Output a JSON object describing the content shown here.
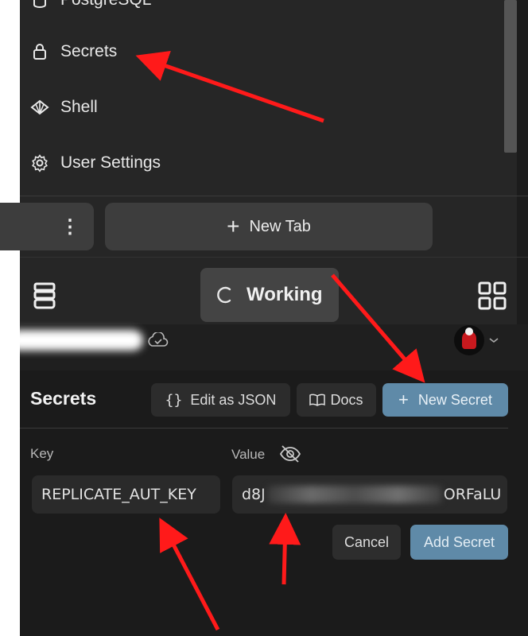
{
  "menu": {
    "items": [
      {
        "label": "PostgreSQL",
        "icon": "database-icon"
      },
      {
        "label": "Secrets",
        "icon": "lock-icon"
      },
      {
        "label": "Shell",
        "icon": "shell-icon"
      },
      {
        "label": "User Settings",
        "icon": "gear-icon"
      }
    ]
  },
  "tabs": {
    "more_icon": "⋮",
    "new_tab_label": "New Tab"
  },
  "toolbar": {
    "working_label": "Working"
  },
  "secrets": {
    "title": "Secrets",
    "edit_json_label": "Edit as JSON",
    "docs_label": "Docs",
    "new_secret_label": "New Secret",
    "key_label": "Key",
    "value_label": "Value",
    "key_value": "REPLICATE_AUT_KEY",
    "value_prefix": "d8J",
    "value_suffix": "ORFaLU",
    "cancel_label": "Cancel",
    "add_secret_label": "Add Secret"
  },
  "colors": {
    "accent": "#5f8aa8",
    "annotation": "#ff1a1a"
  }
}
